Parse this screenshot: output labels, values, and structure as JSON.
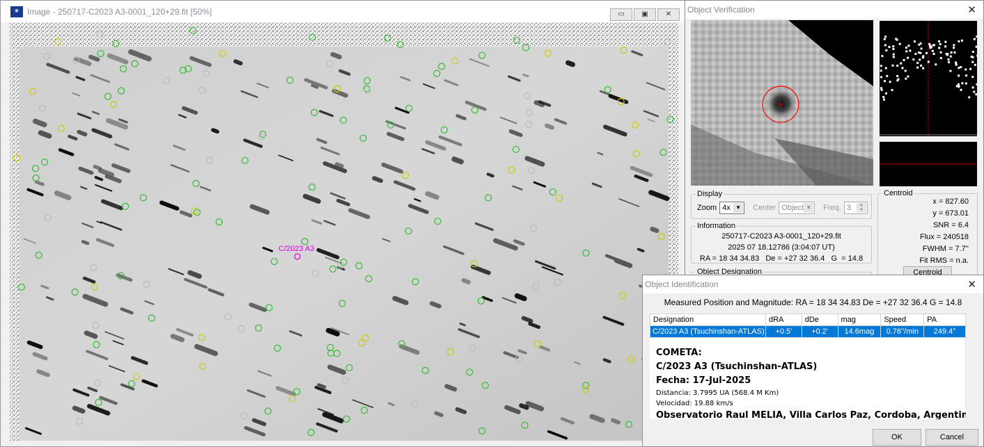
{
  "image_window": {
    "title": "Image - 250717-C2023 A3-0001_120+29.fit [50%]",
    "comet_label": "C/2023 A3",
    "buttons": {
      "minimize": "▭",
      "restore": "▣",
      "close": "✕"
    }
  },
  "object_verification": {
    "title": "Object Verification",
    "close": "✕",
    "display": {
      "group_label": "Display",
      "zoom_label": "Zoom",
      "zoom_value": "4x",
      "center_label": "Center",
      "center_value": "Object",
      "freq_label": "Freq.",
      "freq_value": "3"
    },
    "information": {
      "group_label": "Information",
      "filename": "250717-C2023 A3-0001_120+29.fit",
      "datetime": "2025 07 18.12786 (3:04:07 UT)",
      "coords": "RA = 18 34 34.83   De = +27 32 36.4   G  = 14.8"
    },
    "designation_group_label": "Object Designation",
    "centroid": {
      "group_label": "Centroid",
      "x": "x = 827.60",
      "y": "y = 673.01",
      "snr": "SNR = 6.4",
      "flux": "Flux = 240518",
      "fwhm": "FWHM = 7.7''",
      "fit_rms": "Fit RMS = n.a.",
      "button": "Centroid"
    }
  },
  "object_identification": {
    "title": "Object Identification",
    "close": "✕",
    "measured": "Measured Position and Magnitude: RA = 18 34 34.83  De = +27 32 36.4  G  = 14.8",
    "columns": [
      "Designation",
      "dRA",
      "dDe",
      "mag",
      "Speed",
      "PA"
    ],
    "row": [
      "C/2023 A3 (Tsuchinshan-ATLAS)",
      "+0.5'",
      "+0.2'",
      "14.6mag",
      "0.76''/min",
      "249.4°"
    ],
    "note": {
      "line1": "COMETA:",
      "line2": "C/2023 A3 (Tsuchinshan-ATLAS)",
      "line3": "Fecha: 17-Jul-2025",
      "line4": "Distancia: 3.7995 UA (568.4 M Km)",
      "line5": "Velocidad: 19.88 km/s",
      "line6": "Observatorio Raul MELIA, Villa Carlos Paz, Cordoba, Argentina"
    },
    "ok_button": "OK",
    "cancel_button": "Cancel"
  }
}
